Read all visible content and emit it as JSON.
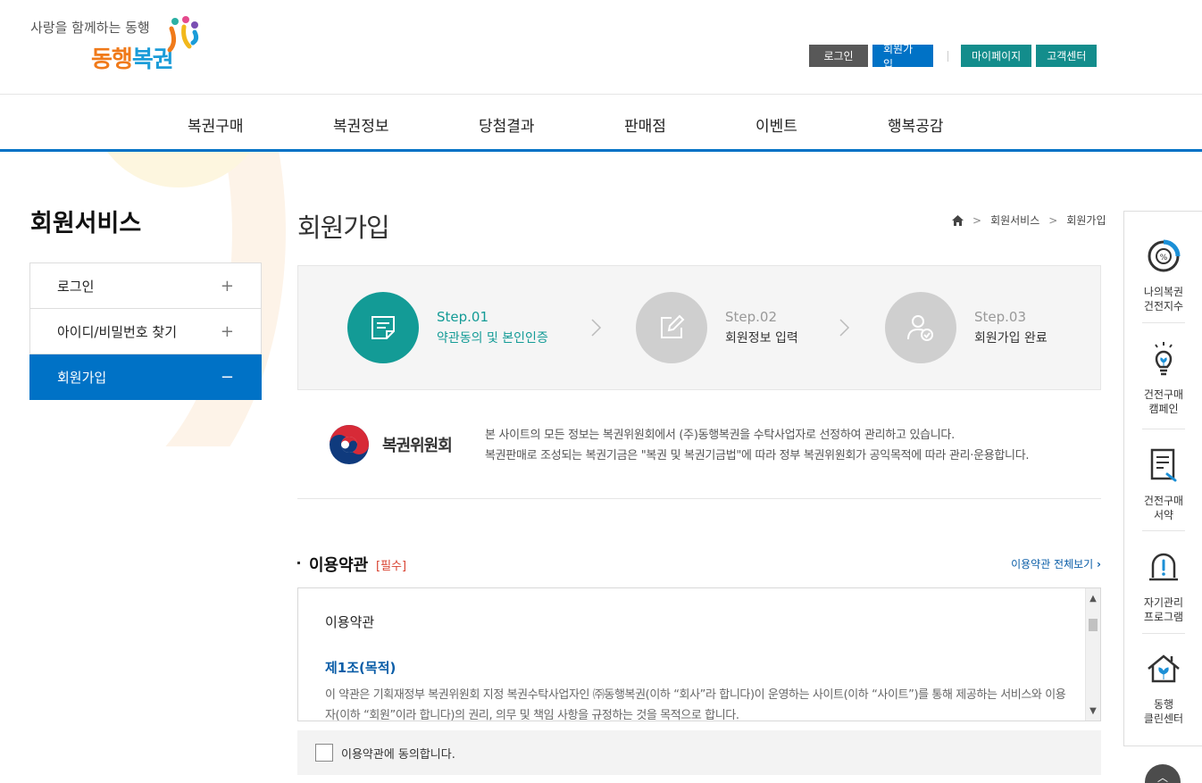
{
  "header": {
    "slogan": "사랑을 함께하는 동행",
    "brand_a": "동행",
    "brand_b": "복권",
    "util": {
      "login": "로그인",
      "join": "회원가입",
      "mypage": "마이페이지",
      "support": "고객센터"
    }
  },
  "gnb": [
    "복권구매",
    "복권정보",
    "당첨결과",
    "판매점",
    "이벤트",
    "행복공감"
  ],
  "lnb": {
    "title": "회원서비스",
    "items": [
      {
        "label": "로그인",
        "mark": "+"
      },
      {
        "label": "아이디/비밀번호 찾기",
        "mark": "+"
      },
      {
        "label": "회원가입",
        "mark": "−"
      }
    ]
  },
  "page": {
    "title": "회원가입",
    "breadcrumb": [
      "회원서비스",
      "회원가입"
    ]
  },
  "steps": [
    {
      "num": "Step.01",
      "label": "약관동의 및 본인인증",
      "icon": "memo-icon"
    },
    {
      "num": "Step.02",
      "label": "회원정보 입력",
      "icon": "edit-icon"
    },
    {
      "num": "Step.03",
      "label": "회원가입 완료",
      "icon": "user-check-icon"
    }
  ],
  "org": {
    "name": "복권위원회",
    "line1": "본 사이트의 모든 정보는 복권위원회에서 (주)동행복권을 수탁사업자로 선정하여 관리하고 있습니다.",
    "line2": "복권판매로 조성되는 복권기금은 \"복권 및 복권기금법\"에 따라 정부 복권위원회가 공익목적에 따라 관리·운용합니다."
  },
  "terms": {
    "title": "이용약관",
    "required": "[필수]",
    "view_all": "이용약관 전체보기",
    "box_heading": "이용약관",
    "article_title": "제1조(목적)",
    "article_body": "이 약관은 기획재정부 복권위원회 지정 복권수탁사업자인 ㈜동행복권(이하 “회사”라 합니다)이 운영하는 사이트(이하 “사이트”)를 통해 제공하는 서비스와 이용자(이하 “회원”이라 합니다)의 권리, 의무 및 책임 사항을 규정하는 것을 목적으로 합니다.",
    "agree_label": "이용약관에 동의합니다."
  },
  "quick": [
    {
      "l1": "나의복권",
      "l2": "건전지수"
    },
    {
      "l1": "건전구매",
      "l2": "캠페인"
    },
    {
      "l1": "건전구매",
      "l2": "서약"
    },
    {
      "l1": "자기관리",
      "l2": "프로그램"
    },
    {
      "l1": "동행",
      "l2": "클린센터"
    }
  ],
  "colors": {
    "primary": "#0072c6",
    "teal": "#139b96",
    "utility_teal": "#138d8c",
    "required": "#d8412f"
  }
}
